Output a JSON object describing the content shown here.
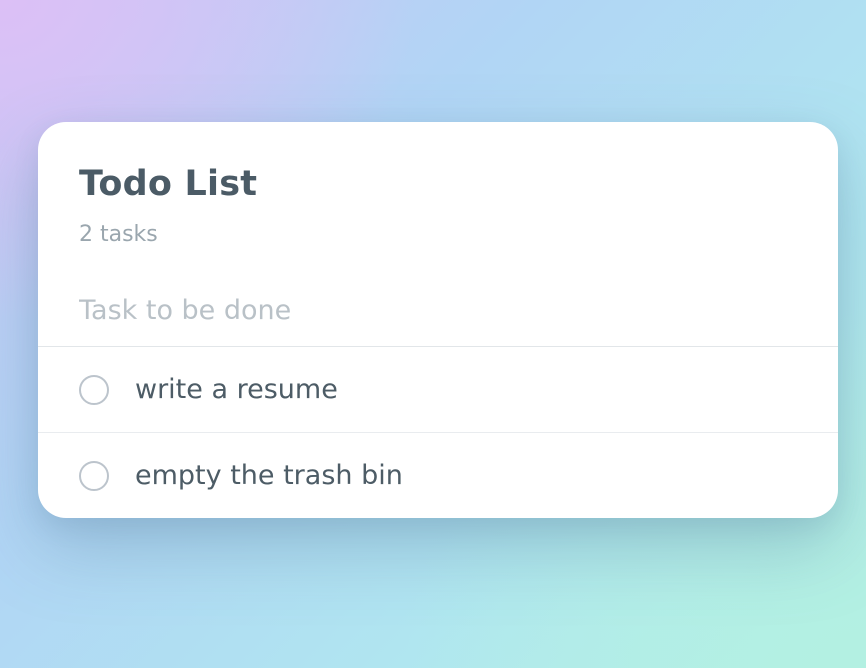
{
  "app": {
    "title": "Todo List",
    "task_count_text": "2 tasks"
  },
  "input": {
    "placeholder": "Task to be done",
    "value": ""
  },
  "tasks": [
    {
      "label": "write a resume",
      "completed": false
    },
    {
      "label": "empty the trash bin",
      "completed": false
    }
  ],
  "colors": {
    "card_bg": "#ffffff",
    "title": "#4b5b66",
    "muted": "#9aa6ae",
    "placeholder": "#b9c1c7",
    "checkbox_border": "#bcc4cc",
    "gradient_top_left": "#dcc0f6",
    "gradient_bottom_right": "#b4f1e6"
  }
}
